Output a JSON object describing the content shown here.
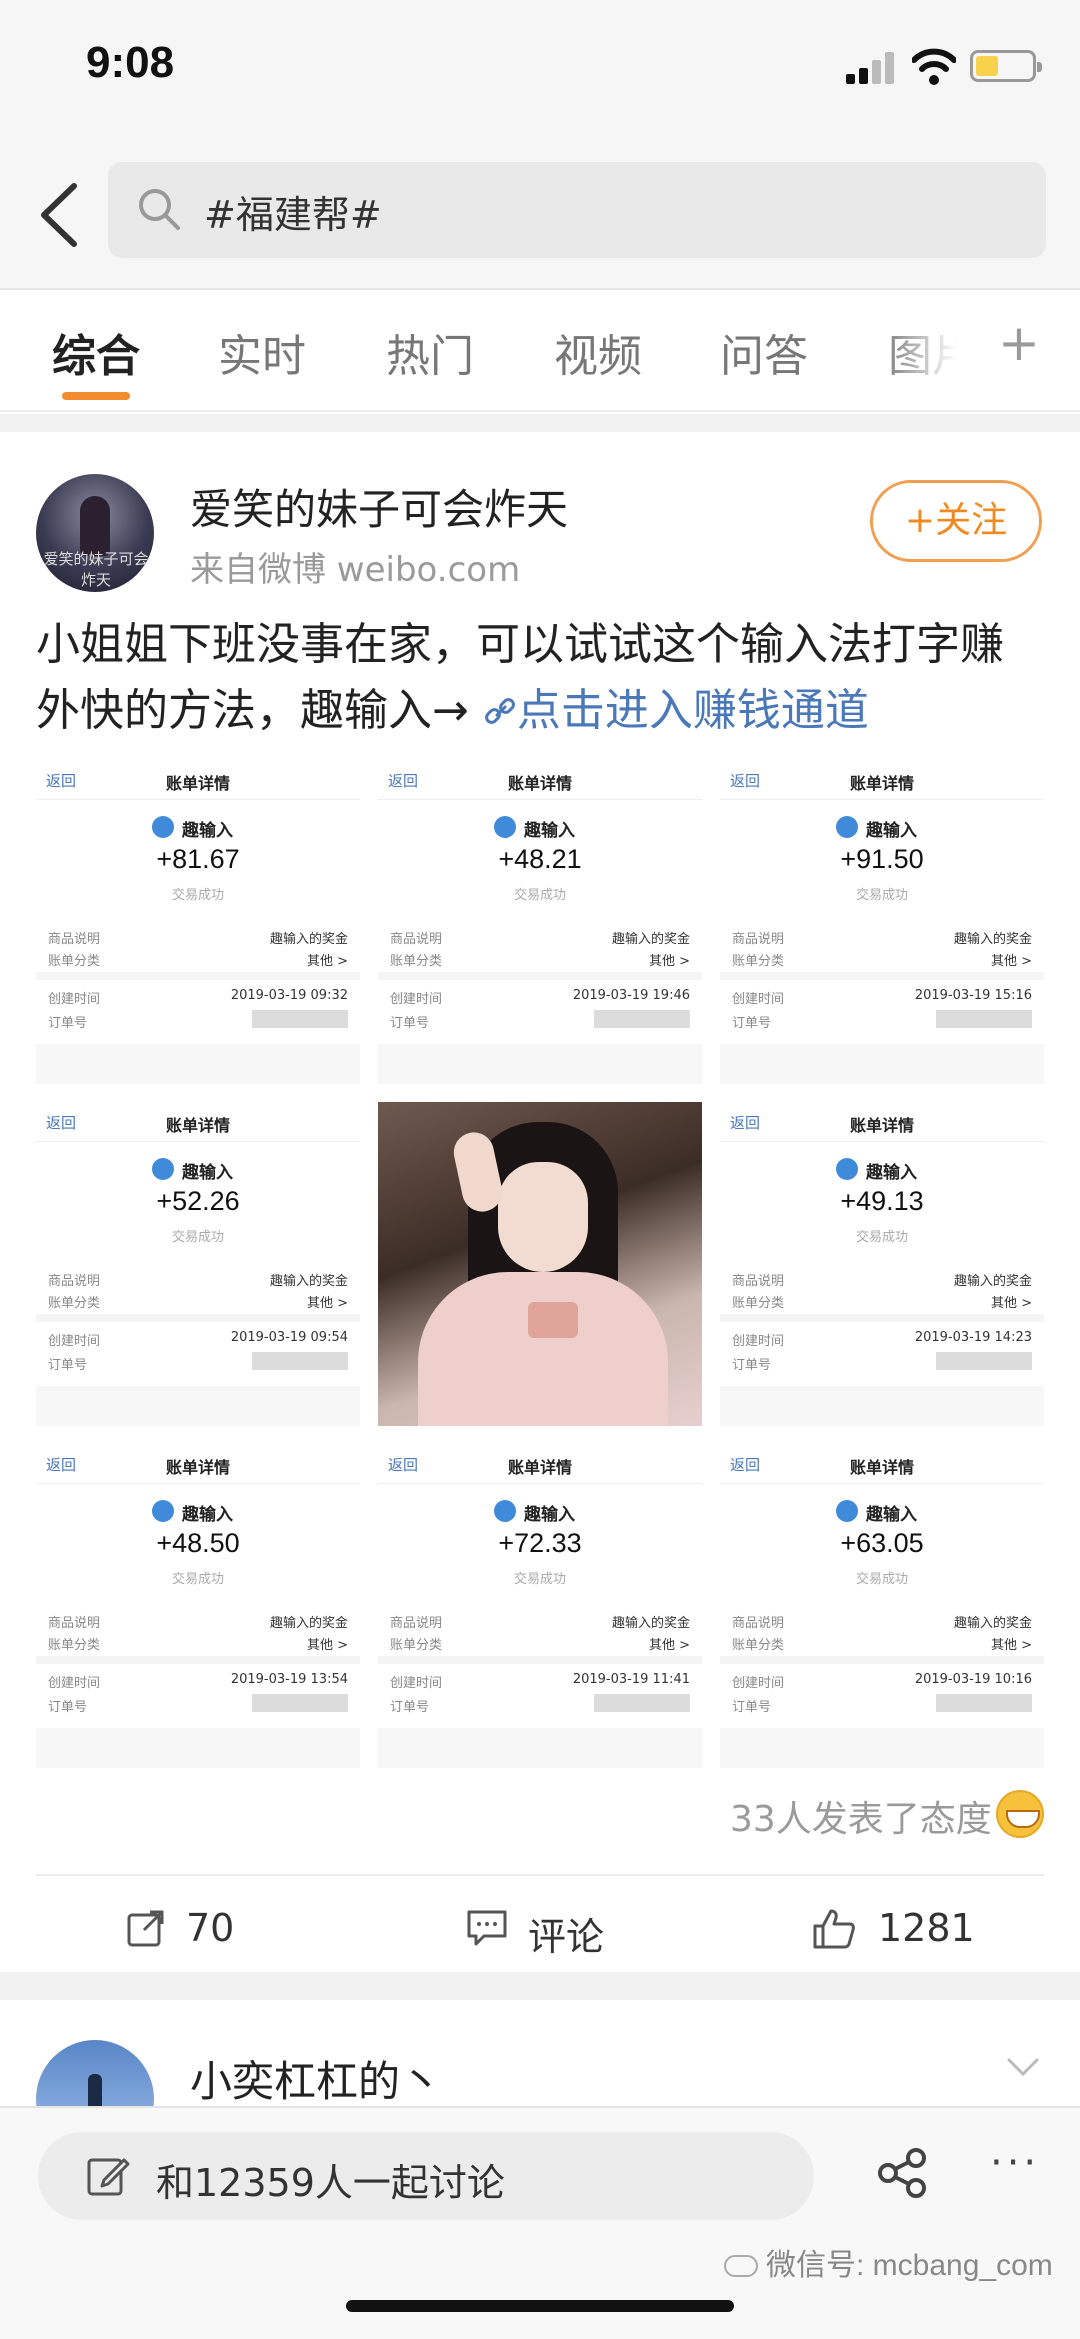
{
  "status": {
    "time": "9:08"
  },
  "search": {
    "query": "#福建帮#"
  },
  "tabs": [
    "综合",
    "实时",
    "热门",
    "视频",
    "问答",
    "图片"
  ],
  "post": {
    "username": "爱笑的妹子可会炸天",
    "source": "来自微博 weibo.com",
    "follow_label": "+关注",
    "avatar_text": "爱笑的妹子可会炸天",
    "text_main": "小姐姐下班没事在家，可以试试这个输入法打字赚外快的方法，趣输入→",
    "link_text": "点击进入赚钱通道",
    "receipt_labels": {
      "back": "返回",
      "title": "账单详情",
      "app": "趣输入",
      "status": "交易成功",
      "item_label": "商品说明",
      "item_value": "趣输入的奖金",
      "category_label": "账单分类",
      "category_value": "其他 >",
      "created_label": "创建时间",
      "order_label": "订单号"
    },
    "receipts": [
      {
        "amount": "+81.67",
        "time": "2019-03-19 09:32"
      },
      {
        "amount": "+48.21",
        "time": "2019-03-19 19:46"
      },
      {
        "amount": "+91.50",
        "time": "2019-03-19 15:16"
      },
      {
        "amount": "+52.26",
        "time": "2019-03-19 09:54"
      },
      {
        "amount": "+49.13",
        "time": "2019-03-19 14:23"
      },
      {
        "amount": "+48.50",
        "time": "2019-03-19 13:54"
      },
      {
        "amount": "+72.33",
        "time": "2019-03-19 11:41"
      },
      {
        "amount": "+63.05",
        "time": "2019-03-19 10:16"
      }
    ],
    "reactions_text": "33人发表了态度",
    "actions": {
      "repost_count": "70",
      "comment_label": "评论",
      "like_count": "1281"
    }
  },
  "next_post": {
    "username": "小奕杠杠的丶"
  },
  "bottom": {
    "discuss_label": "和12359人一起讨论",
    "more": "···"
  },
  "watermark": "微信号: mcbang_com",
  "colors": {
    "accent": "#f08c2c",
    "link": "#4a78b8"
  }
}
